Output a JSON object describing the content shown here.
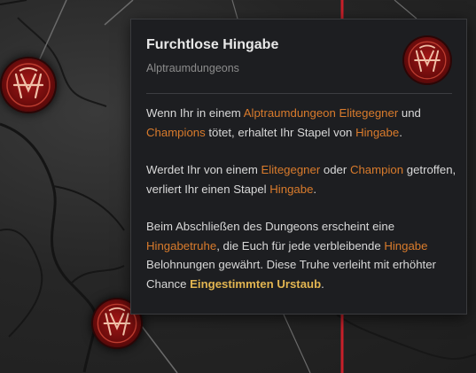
{
  "tooltip": {
    "title": "Furchtlose Hingabe",
    "subtitle": "Alptraumdungeons",
    "para1": {
      "t1": "Wenn Ihr in einem ",
      "h1": "Alptraumdungeon Elitegegner",
      "t2": " und ",
      "h2": "Champions",
      "t3": " tötet, erhaltet Ihr Stapel von ",
      "h3": "Hingabe",
      "t4": "."
    },
    "para2": {
      "t1": "Werdet Ihr von einem ",
      "h1": "Elitegegner",
      "t2": " oder ",
      "h2": "Champion",
      "t3": " getroffen, verliert Ihr einen Stapel ",
      "h3": "Hingabe",
      "t4": "."
    },
    "para3": {
      "t1": "Beim Abschließen des Dungeons erscheint eine ",
      "h1": "Hingabetruhe",
      "t2": ", die Euch für jede verbleibende ",
      "h2": "Hingabe",
      "t3": " Belohnungen gewährt. Diese Truhe verleiht mit erhöhter Chance ",
      "h3": "Eingestimmten Urstaub",
      "t4": "."
    },
    "icon": "nightmare-sigil-icon"
  },
  "colors": {
    "highlight": "#d97b2c",
    "highlight_gold": "#e2b551",
    "path_red": "#c8202a",
    "node_red": "#a31717"
  },
  "map_nodes": [
    "nightmare-sigil-icon",
    "nightmare-sigil-icon"
  ]
}
